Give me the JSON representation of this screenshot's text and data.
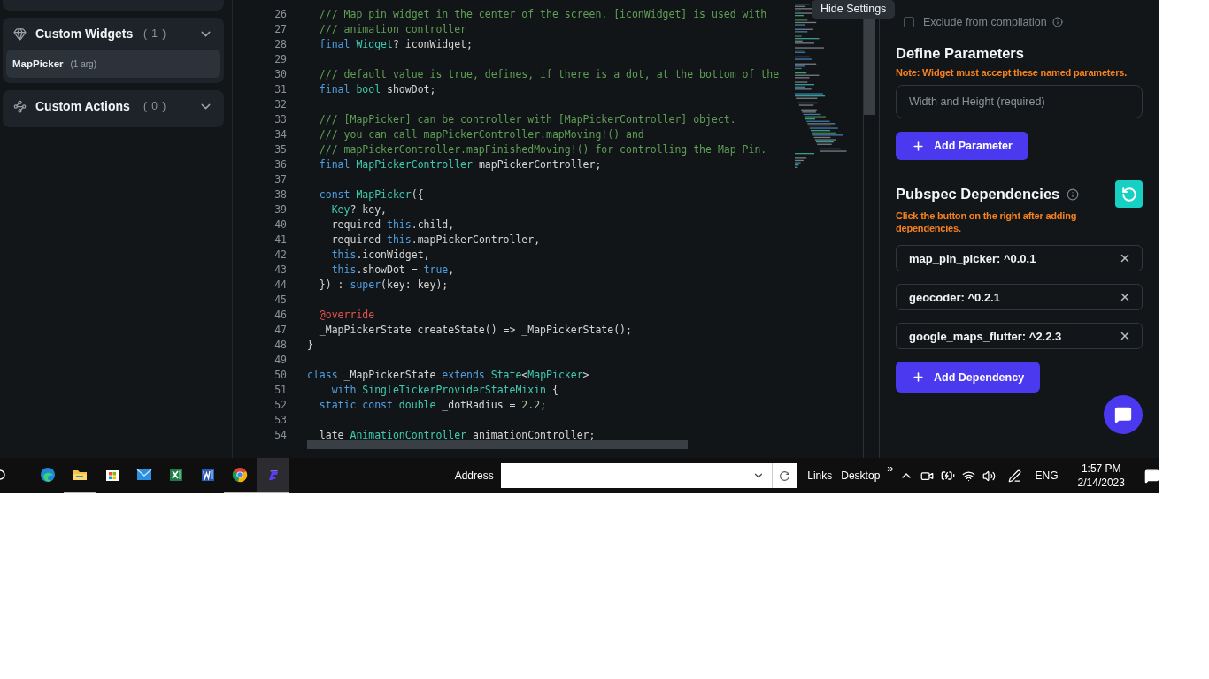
{
  "sidebar": {
    "sections": [
      {
        "kind": "widgets",
        "title": "Custom Widgets",
        "count": "( 1 )",
        "expanded": true,
        "items": [
          {
            "name": "MapPicker",
            "detail": "(1 arg)",
            "selected": true
          }
        ]
      },
      {
        "kind": "actions",
        "title": "Custom Actions",
        "count": "( 0 )"
      }
    ]
  },
  "editor": {
    "lines": [
      {
        "number": "26",
        "tokens": [
          {
            "kind": "comment",
            "text": "  /// Map pin widget in the center of the screen. [iconWidget] is used with"
          }
        ]
      },
      {
        "number": "27",
        "tokens": [
          {
            "kind": "comment",
            "text": "  /// animation controller"
          }
        ]
      },
      {
        "number": "28",
        "tokens": [
          {
            "kind": "keyword",
            "text": "  final"
          },
          {
            "kind": "type",
            "text": " Widget"
          },
          {
            "kind": "plain",
            "text": "? iconWidget;"
          }
        ]
      },
      {
        "number": "29"
      },
      {
        "number": "30",
        "tokens": [
          {
            "kind": "comment",
            "text": "  /// default value is true, defines, if there is a dot, at the bottom of the"
          }
        ]
      },
      {
        "number": "31",
        "tokens": [
          {
            "kind": "keyword",
            "text": "  final"
          },
          {
            "kind": "type",
            "text": " bool"
          },
          {
            "kind": "plain",
            "text": " showDot;"
          }
        ]
      },
      {
        "number": "32"
      },
      {
        "number": "33",
        "tokens": [
          {
            "kind": "comment",
            "text": "  /// [MapPicker] can be controller with [MapPickerController] object."
          }
        ]
      },
      {
        "number": "34",
        "tokens": [
          {
            "kind": "comment",
            "text": "  /// you can call mapPickerController.mapMoving!() and"
          }
        ]
      },
      {
        "number": "35",
        "tokens": [
          {
            "kind": "comment",
            "text": "  /// mapPickerController.mapFinishedMoving!() for controlling the Map Pin."
          }
        ]
      },
      {
        "number": "36",
        "tokens": [
          {
            "kind": "keyword",
            "text": "  final"
          },
          {
            "kind": "type",
            "text": " MapPickerController"
          },
          {
            "kind": "plain",
            "text": " mapPickerController;"
          }
        ]
      },
      {
        "number": "37"
      },
      {
        "number": "38",
        "tokens": [
          {
            "kind": "keyword",
            "text": "  const"
          },
          {
            "kind": "type",
            "text": " MapPicker"
          },
          {
            "kind": "plain",
            "text": "({"
          }
        ]
      },
      {
        "number": "39",
        "tokens": [
          {
            "kind": "type",
            "text": "    Key"
          },
          {
            "kind": "plain",
            "text": "? key,"
          }
        ]
      },
      {
        "number": "40",
        "tokens": [
          {
            "kind": "plain",
            "text": "    required "
          },
          {
            "kind": "keyword",
            "text": "this"
          },
          {
            "kind": "plain",
            "text": ".child,"
          }
        ]
      },
      {
        "number": "41",
        "tokens": [
          {
            "kind": "plain",
            "text": "    required "
          },
          {
            "kind": "keyword",
            "text": "this"
          },
          {
            "kind": "plain",
            "text": ".mapPickerController,"
          }
        ]
      },
      {
        "number": "42",
        "tokens": [
          {
            "kind": "keyword",
            "text": "    this"
          },
          {
            "kind": "plain",
            "text": ".iconWidget,"
          }
        ]
      },
      {
        "number": "43",
        "tokens": [
          {
            "kind": "keyword",
            "text": "    this"
          },
          {
            "kind": "plain",
            "text": ".showDot = "
          },
          {
            "kind": "keyword",
            "text": "true"
          },
          {
            "kind": "plain",
            "text": ","
          }
        ]
      },
      {
        "number": "44",
        "tokens": [
          {
            "kind": "plain",
            "text": "  }) : "
          },
          {
            "kind": "keyword",
            "text": "super"
          },
          {
            "kind": "plain",
            "text": "(key: key);"
          }
        ]
      },
      {
        "number": "45"
      },
      {
        "number": "46",
        "tokens": [
          {
            "kind": "annotation",
            "text": "  @override"
          }
        ]
      },
      {
        "number": "47",
        "tokens": [
          {
            "kind": "plain",
            "text": "  _MapPickerState createState() => _MapPickerState();"
          }
        ]
      },
      {
        "number": "48",
        "tokens": [
          {
            "kind": "plain",
            "text": "}"
          }
        ]
      },
      {
        "number": "49"
      },
      {
        "number": "50",
        "tokens": [
          {
            "kind": "keyword",
            "text": "class"
          },
          {
            "kind": "plain",
            "text": " _MapPickerState "
          },
          {
            "kind": "keyword",
            "text": "extends"
          },
          {
            "kind": "type",
            "text": " State"
          },
          {
            "kind": "plain",
            "text": "<"
          },
          {
            "kind": "type",
            "text": "MapPicker"
          },
          {
            "kind": "plain",
            "text": ">"
          }
        ]
      },
      {
        "number": "51",
        "tokens": [
          {
            "kind": "keyword",
            "text": "    with"
          },
          {
            "kind": "type",
            "text": " SingleTickerProviderStateMixin"
          },
          {
            "kind": "plain",
            "text": " {"
          }
        ]
      },
      {
        "number": "52",
        "tokens": [
          {
            "kind": "keyword",
            "text": "  static const"
          },
          {
            "kind": "type",
            "text": " double"
          },
          {
            "kind": "plain",
            "text": " _dotRadius = "
          },
          {
            "kind": "number",
            "text": "2.2"
          },
          {
            "kind": "plain",
            "text": ";"
          }
        ]
      },
      {
        "number": "53"
      },
      {
        "number": "54",
        "tokens": [
          {
            "kind": "plain",
            "text": "  late "
          },
          {
            "kind": "type",
            "text": "AnimationController"
          },
          {
            "kind": "plain",
            "text": " animationController;"
          }
        ]
      }
    ]
  },
  "tooltip": "Hide Settings",
  "settings": {
    "exclude": {
      "label": "Exclude from compilation",
      "checked": false
    },
    "parameters": {
      "title": "Define Parameters",
      "note": "Note: Widget must accept these named parameters.",
      "placeholder": "Width and Height (required)",
      "add_button": "Add Parameter"
    },
    "dependencies": {
      "title": "Pubspec Dependencies",
      "note": "Click the button on the right after adding dependencies.",
      "items": [
        {
          "label": "map_pin_picker: ^0.0.1"
        },
        {
          "label": "geocoder: ^0.2.1"
        },
        {
          "label": "google_maps_flutter: ^2.2.3"
        }
      ],
      "add_button": "Add Dependency"
    }
  },
  "taskbar": {
    "apps": [
      {
        "kind": "search",
        "running": false,
        "selected": false
      },
      {
        "kind": "edge",
        "running": false,
        "selected": false
      },
      {
        "kind": "explorer",
        "running": true,
        "selected": false
      },
      {
        "kind": "store",
        "running": false,
        "selected": false
      },
      {
        "kind": "mail",
        "running": false,
        "selected": false
      },
      {
        "kind": "excel",
        "running": false,
        "selected": false
      },
      {
        "kind": "word",
        "running": false,
        "selected": false
      },
      {
        "kind": "chrome",
        "running": true,
        "selected": false
      },
      {
        "kind": "flutterflow",
        "running": true,
        "selected": true
      }
    ],
    "address_label": "Address",
    "toolbars": [
      "Links",
      "Desktop"
    ],
    "overflow": "»",
    "language": "ENG",
    "time": "1:57 PM",
    "date": "2/14/2023"
  }
}
